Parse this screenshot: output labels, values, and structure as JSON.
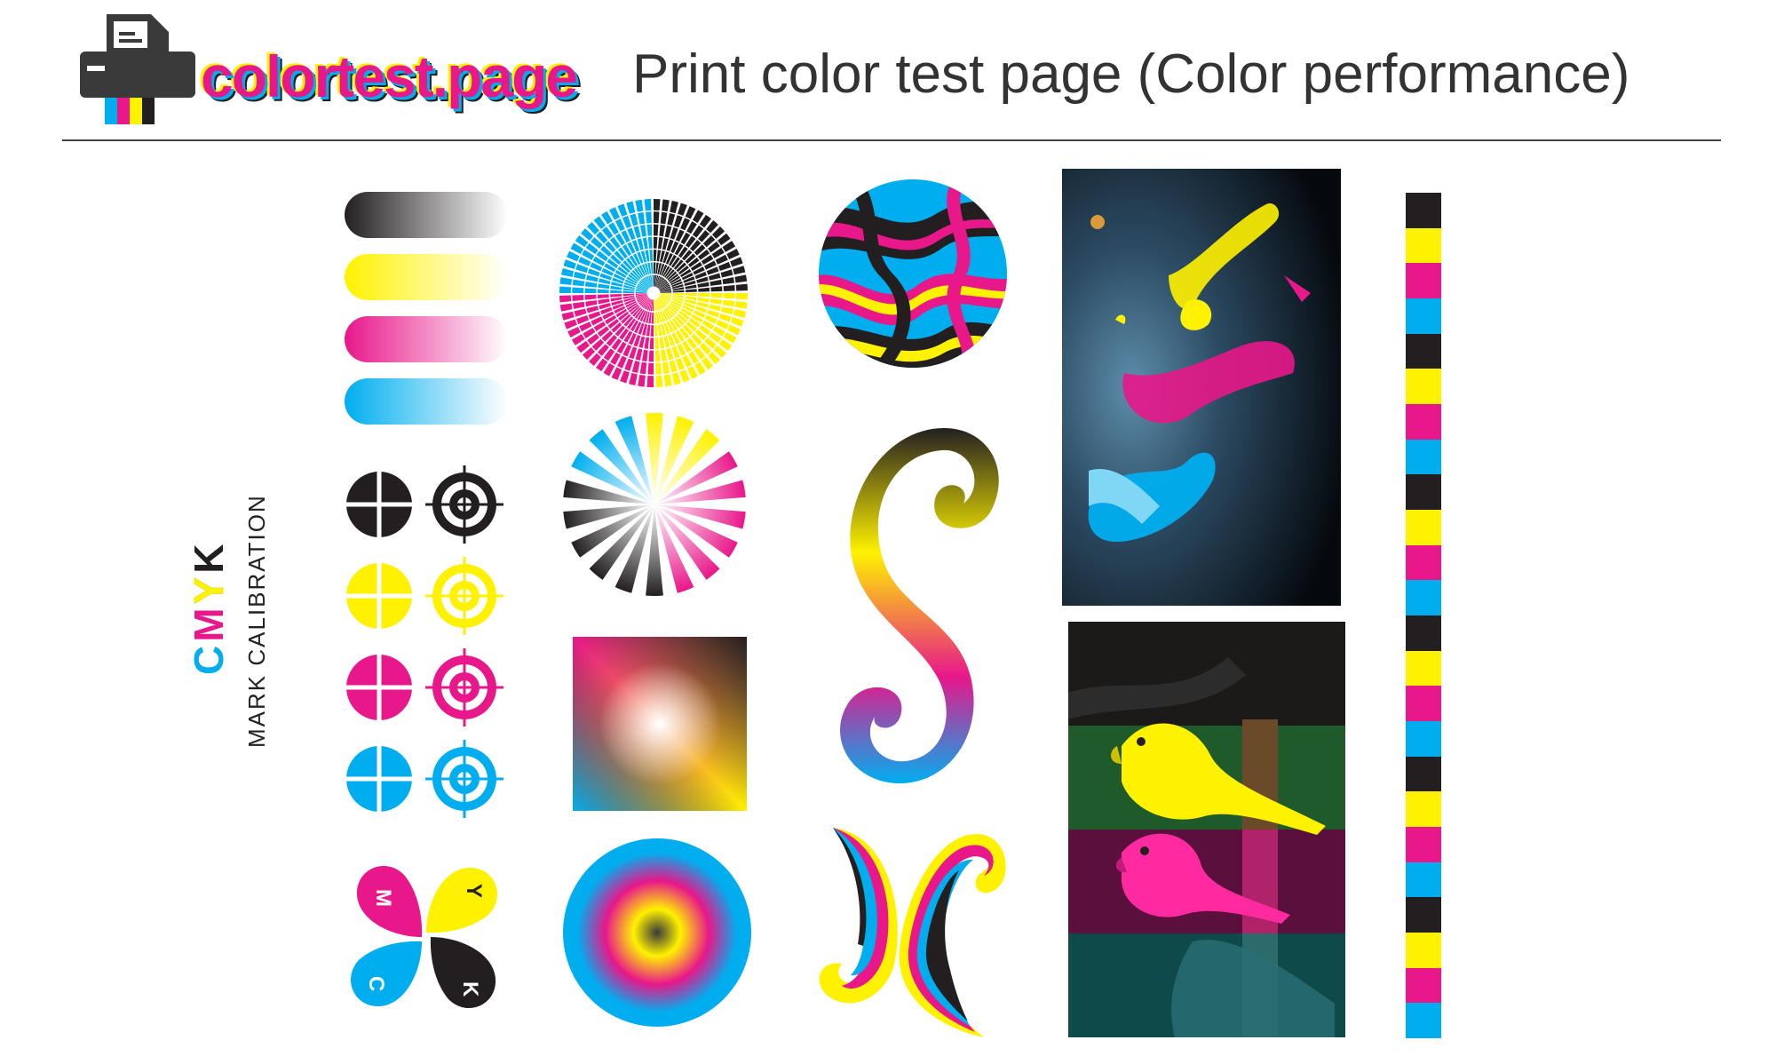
{
  "header": {
    "logo_text": "colortest.page",
    "title": "Print color test page (Color performance)"
  },
  "side_label": {
    "cmyk_letters": [
      {
        "letter": "C",
        "color": "#00aeef"
      },
      {
        "letter": "M",
        "color": "#e8178a"
      },
      {
        "letter": "Y",
        "color": "#fff200"
      },
      {
        "letter": "K",
        "color": "#231f20"
      }
    ],
    "caption": "MARK CALIBRATION"
  },
  "colors": {
    "cyan": "#00aeef",
    "magenta": "#e8178a",
    "yellow": "#fff200",
    "black": "#231f20"
  },
  "gradient_bars": [
    "black",
    "yellow",
    "magenta",
    "cyan"
  ],
  "calibration_marks": [
    "black",
    "yellow",
    "magenta",
    "cyan"
  ],
  "flower_petals": [
    {
      "letter": "M",
      "color": "#e8178a"
    },
    {
      "letter": "Y",
      "color": "#fff200"
    },
    {
      "letter": "C",
      "color": "#00aeef"
    },
    {
      "letter": "K",
      "color": "#231f20"
    }
  ],
  "color_strip_sequence": [
    "black",
    "yellow",
    "magenta",
    "cyan",
    "black",
    "yellow",
    "magenta",
    "cyan",
    "black",
    "yellow",
    "magenta",
    "cyan",
    "black",
    "yellow",
    "magenta",
    "cyan",
    "black",
    "yellow",
    "magenta",
    "cyan",
    "black",
    "yellow",
    "magenta",
    "cyan"
  ]
}
